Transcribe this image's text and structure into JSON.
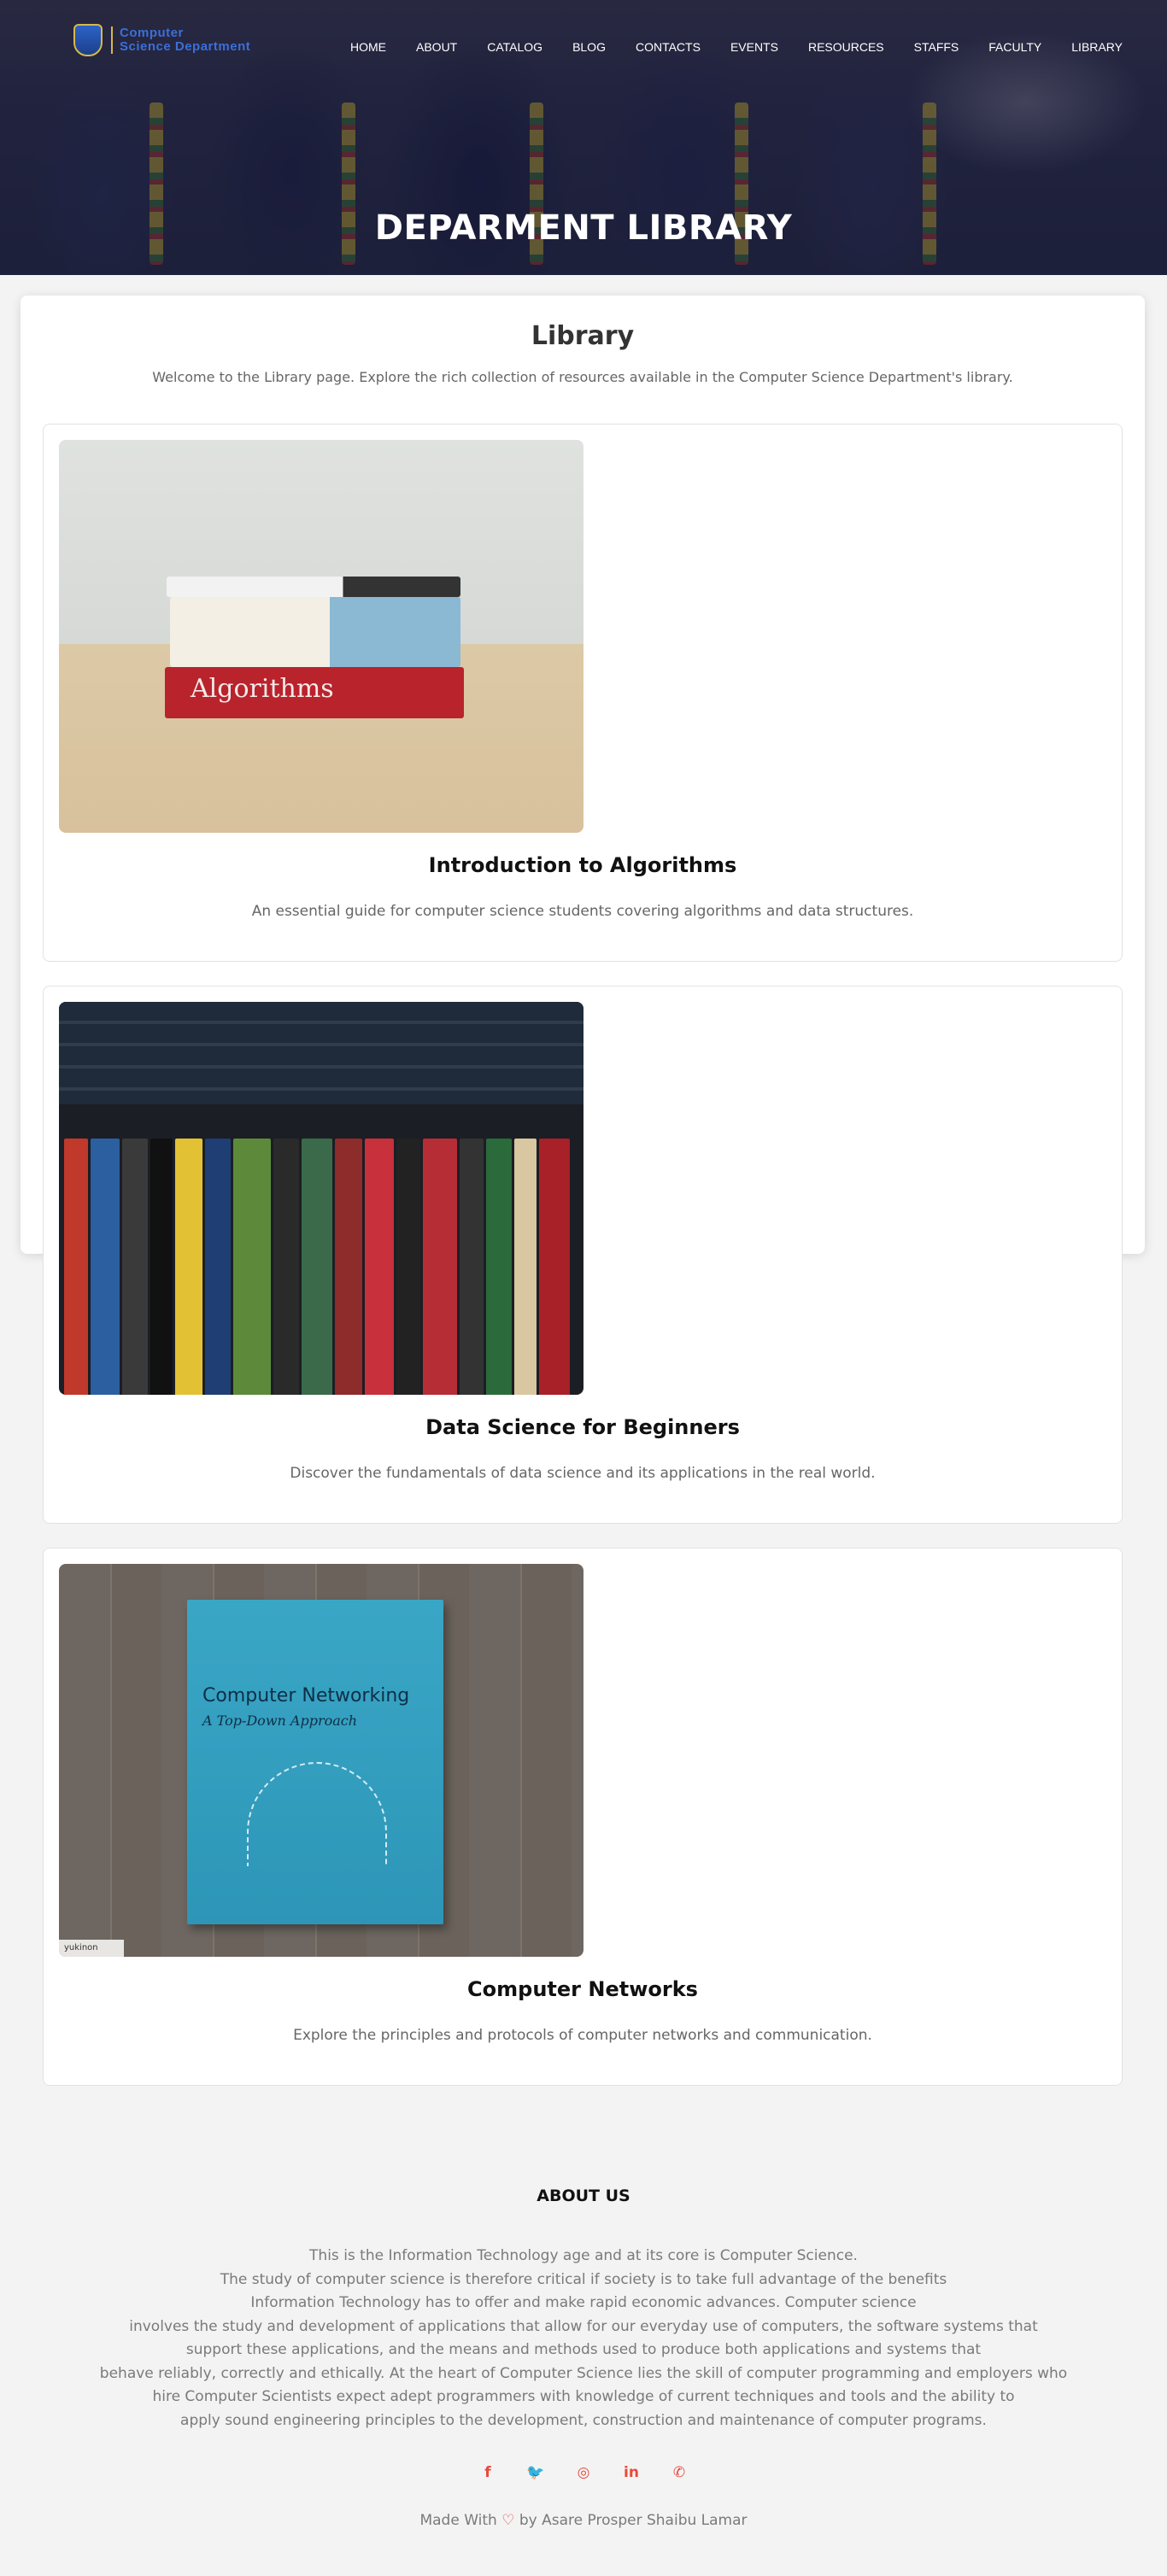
{
  "logo": {
    "line1": "Computer",
    "line2": "Science Department"
  },
  "nav": {
    "items": [
      "HOME",
      "ABOUT",
      "CATALOG",
      "BLOG",
      "CONTACTS",
      "EVENTS",
      "RESOURCES",
      "STAFFS",
      "FACULTY",
      "LIBRARY"
    ]
  },
  "hero": {
    "title": "DEPARMENT LIBRARY"
  },
  "library": {
    "title": "Library",
    "intro": "Welcome to the Library page. Explore the rich collection of resources available in the Computer Science Department's library.",
    "books": [
      {
        "title": "Introduction to Algorithms",
        "description": "An essential guide for computer science students covering algorithms and data structures.",
        "cover_text": "Algorithms"
      },
      {
        "title": "Data Science for Beginners",
        "description": "Discover the fundamentals of data science and its applications in the real world."
      },
      {
        "title": "Computer Networks",
        "description": "Explore the principles and protocols of computer networks and communication.",
        "cover_title": "Computer Networking",
        "cover_subtitle": "A Top-Down Approach",
        "cover_watermark": "yukinon"
      }
    ]
  },
  "footer": {
    "about_title": "ABOUT US",
    "about_lines": [
      "This is the Information Technology age and at its core is Computer Science.",
      "The study of computer science is therefore critical if society is to take full advantage of the benefits",
      "Information Technology has to offer and make rapid economic advances. Computer science",
      "involves the study and development of applications that allow for our everyday use of computers, the software systems that",
      "support these applications, and the means and methods used to produce both applications and systems that",
      "behave reliably, correctly and ethically. At the heart of Computer Science lies the skill of computer programming and employers who",
      "hire Computer Scientists expect adept programmers with knowledge of current techniques and tools and the ability to",
      "apply sound engineering principles to the development, construction and maintenance of computer programs."
    ],
    "social": [
      {
        "icon": "facebook-icon",
        "glyph": "f"
      },
      {
        "icon": "twitter-icon",
        "glyph": "🐦"
      },
      {
        "icon": "instagram-icon",
        "glyph": "◎"
      },
      {
        "icon": "linkedin-icon",
        "glyph": "in"
      },
      {
        "icon": "whatsapp-icon",
        "glyph": "✆"
      }
    ],
    "credit_prefix": "Made With",
    "credit_suffix": "by Asare Prosper Shaibu Lamar"
  },
  "colors": {
    "accent": "#e84a3c",
    "nav_text": "#ffffff",
    "logo_blue": "#3b6fd8"
  }
}
